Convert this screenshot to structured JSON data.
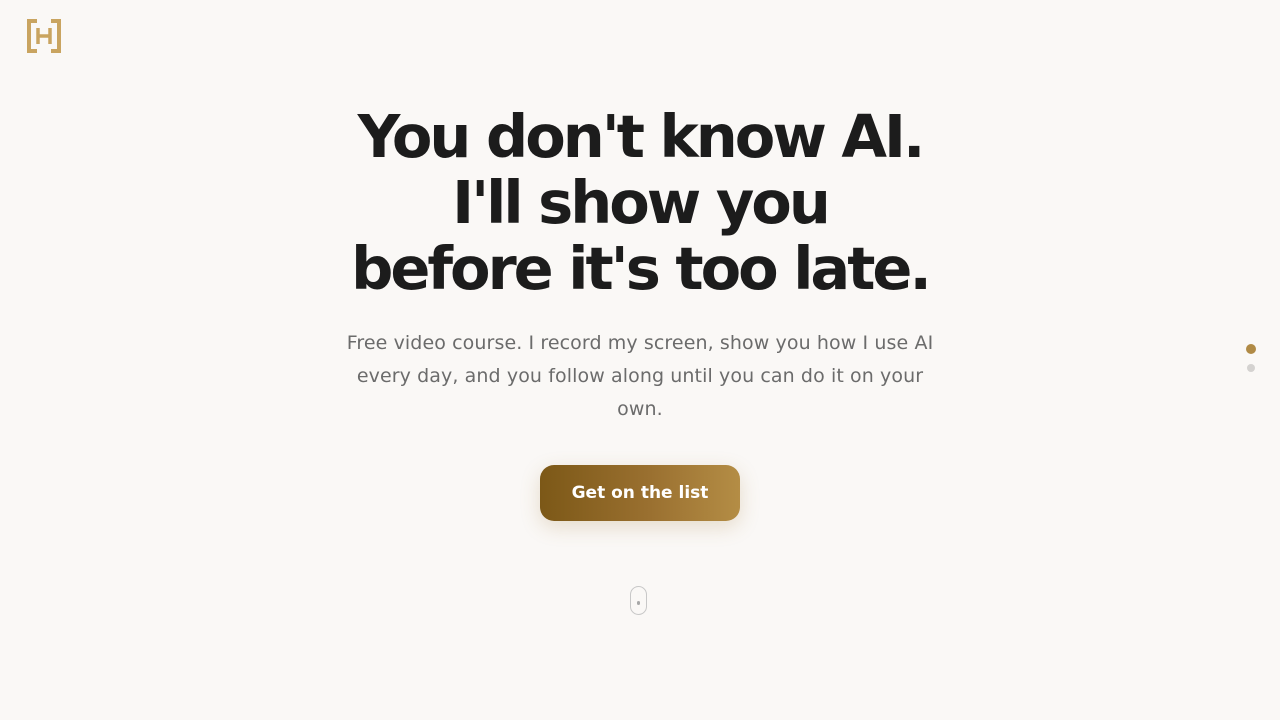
{
  "brand": {
    "logo_icon": "bracket-h-logo-icon",
    "accent_color": "#b08a45"
  },
  "hero": {
    "headline_lines": [
      "You don't know AI.",
      "I'll show you",
      "before it's too late."
    ],
    "subtext": "Free video course. I record my screen, show you how I use AI every day, and you follow along until you can do it on your own."
  },
  "cta": {
    "label": "Get on the list"
  },
  "scroll_indicator": {
    "icon": "mouse-scroll-icon"
  },
  "section_nav": {
    "active_index": 0,
    "dots": [
      {
        "color": "#b08a45"
      },
      {
        "color": "#d4d2d0"
      }
    ]
  }
}
